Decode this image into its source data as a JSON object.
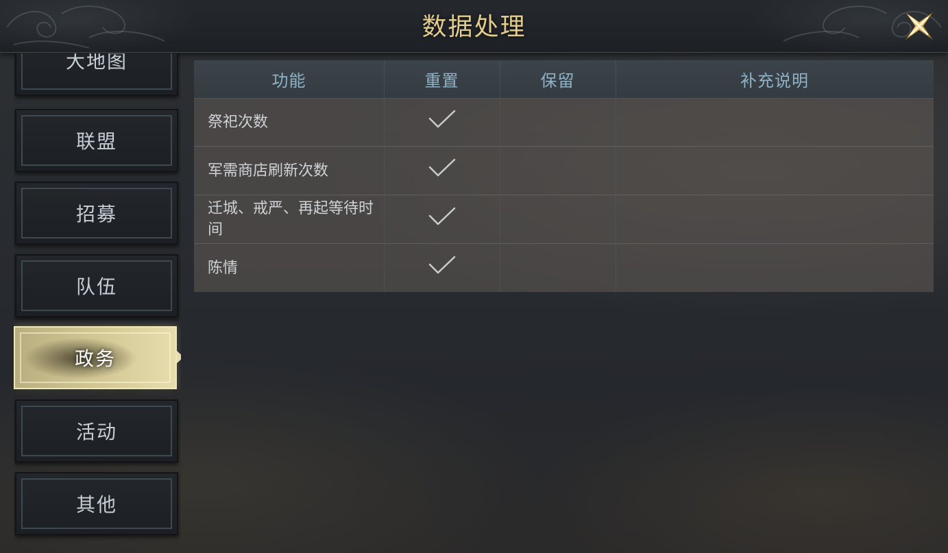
{
  "header": {
    "title": "数据处理"
  },
  "sidebar": {
    "items": [
      {
        "label": "大地图"
      },
      {
        "label": "联盟"
      },
      {
        "label": "招募"
      },
      {
        "label": "队伍"
      },
      {
        "label": "政务",
        "active": true
      },
      {
        "label": "活动"
      },
      {
        "label": "其他"
      }
    ]
  },
  "table": {
    "columns": [
      "功能",
      "重置",
      "保留",
      "补充说明"
    ],
    "rows": [
      {
        "function": "祭祀次数",
        "reset": true,
        "keep": false,
        "note": ""
      },
      {
        "function": "军需商店刷新次数",
        "reset": true,
        "keep": false,
        "note": ""
      },
      {
        "function": "迁城、戒严、再起等待时间",
        "reset": true,
        "keep": false,
        "note": ""
      },
      {
        "function": "陈情",
        "reset": true,
        "keep": false,
        "note": ""
      }
    ]
  },
  "icons": {
    "close": "close-icon",
    "check": "checkmark-icon"
  },
  "colors": {
    "title_gold": "#e2cc8e",
    "header_text_blue": "#8fb2c7",
    "active_tab": "#d4c996"
  }
}
